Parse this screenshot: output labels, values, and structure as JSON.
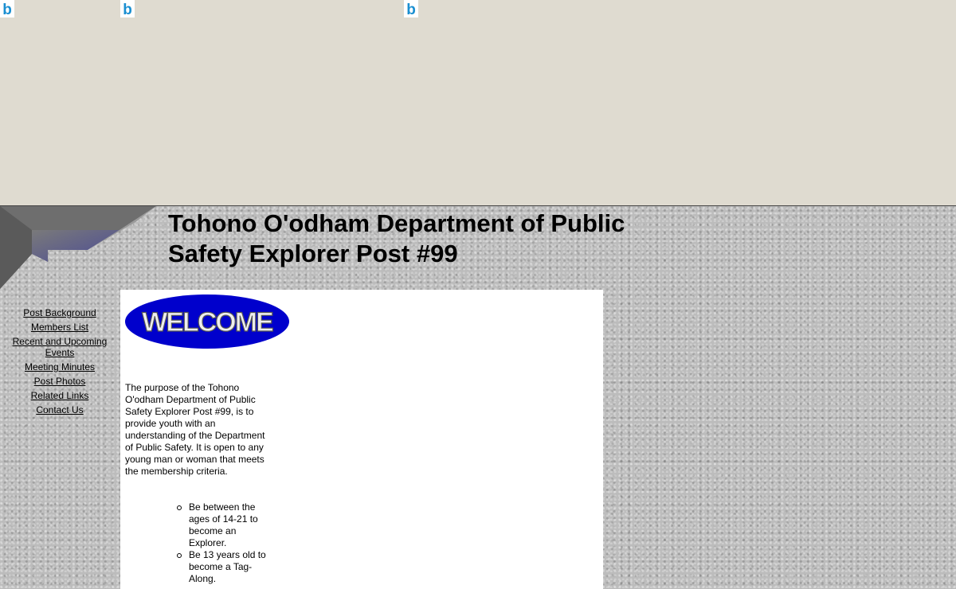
{
  "ads": {
    "icon_glyph": "b",
    "icon_name": "bing-icon",
    "icon_color": "#1a8fd1"
  },
  "page": {
    "title": "Tohono O'odham Department of Public Safety Explorer Post #99"
  },
  "nav": {
    "items": [
      "Post Background",
      "Members List",
      "Recent and Upcoming Events",
      "Meeting Minutes",
      "Post Photos",
      "Related Links",
      "Contact Us"
    ]
  },
  "content": {
    "welcome_banner": "WELCOME",
    "intro": "The purpose of the Tohono O'odham Department of Public Safety Explorer Post #99, is to provide youth with an understanding of the Department of Public Safety.  It is open to any young man or woman that meets the membership criteria.",
    "criteria": [
      "Be between the ages of 14-21 to become an Explorer.",
      "Be 13 years old to become a Tag-Along."
    ]
  },
  "colors": {
    "top_frame_bg": "#dfdbd0",
    "welcome_ellipse": "#0000cc",
    "page_bg": "#bcbcbc"
  }
}
